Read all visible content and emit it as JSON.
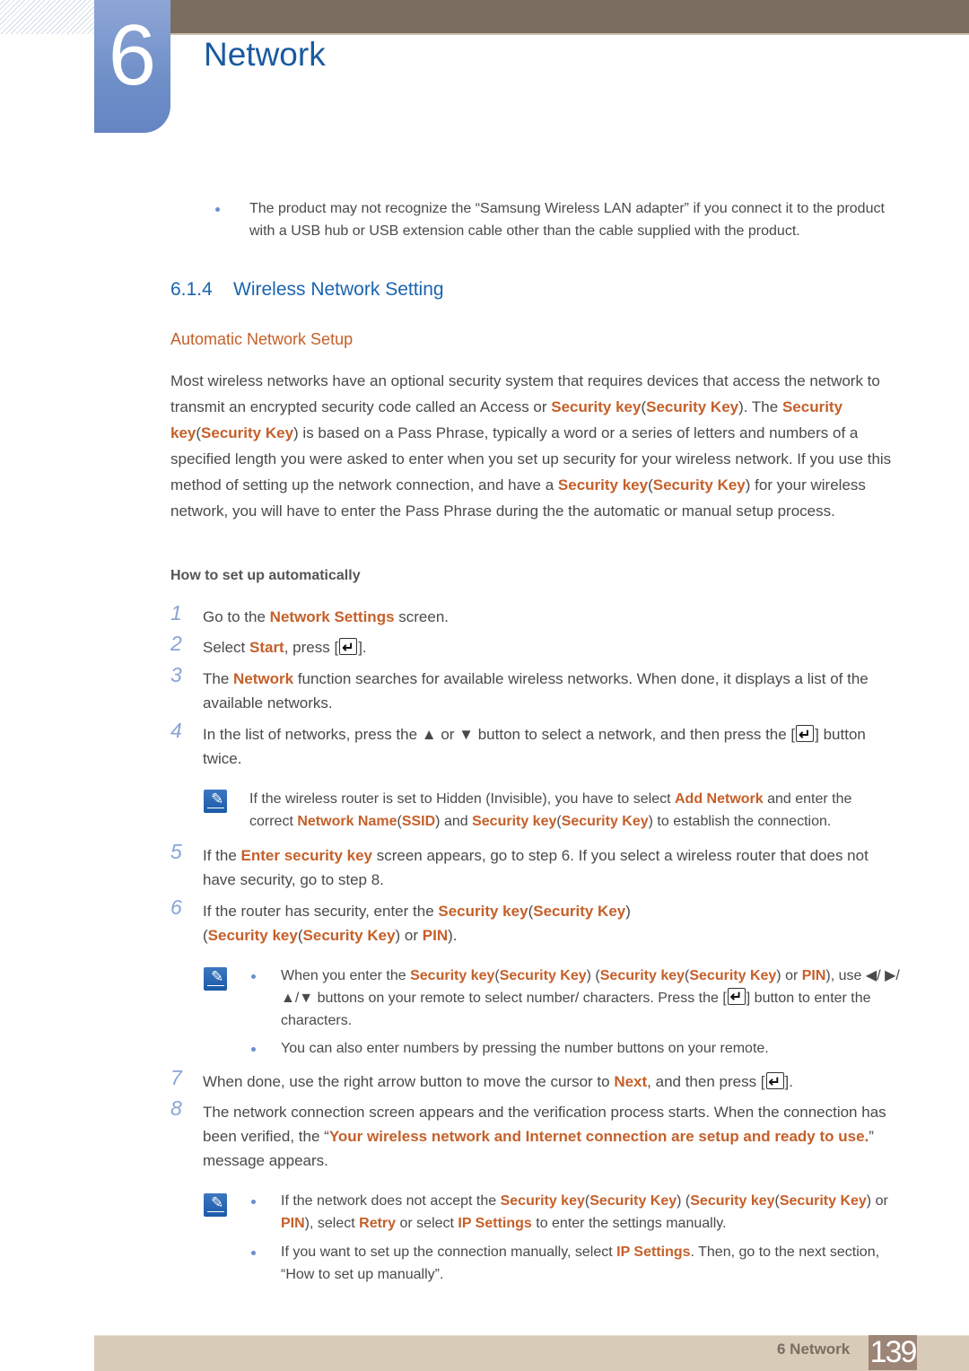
{
  "chapter": {
    "number": "6",
    "title": "Network"
  },
  "intro_bullet": "The product may not recognize the “Samsung Wireless LAN adapter” if you connect it to the product with a USB hub or USB extension cable other than the cable supplied with the product.",
  "section": {
    "number": "6.1.4",
    "title": "Wireless Network Setting"
  },
  "subsection": "Automatic Network Setup",
  "paragraph": {
    "p1": "Most wireless networks have an optional security system that requires devices that access the network to transmit an encrypted security code called an Access or ",
    "k1": "Security key",
    "p2": "(",
    "k2": "Security Key",
    "p3": "). The ",
    "k3": "Security key",
    "p4": "(",
    "k4": "Security Key",
    "p5": ") is based on a Pass Phrase, typically a word or a series of letters and numbers of a specified length you were asked to enter when you set up security for your wireless network. If you use this method of setting up the network connection, and have a ",
    "k5": "Security key",
    "p6": "(",
    "k6": "Security Key",
    "p7": ") for your wireless network, you will have to enter the Pass Phrase during the the automatic or manual setup process."
  },
  "how_to_heading": "How to set up automatically",
  "steps": [
    {
      "n": "1",
      "a": "Go to the ",
      "k": "Network Settings",
      "b": " screen."
    },
    {
      "n": "2",
      "a": "Select ",
      "k": "Start",
      "b": ", press [",
      "c": "]."
    },
    {
      "n": "3",
      "a": "The ",
      "k": "Network",
      "b": " function searches for available wireless networks. When done, it displays a list of the available networks."
    },
    {
      "n": "4",
      "a": "In the list of networks, press the ▲ or ▼ button to select a network, and then press the [",
      "b": "] button twice."
    },
    {
      "n": "5",
      "a": "If the ",
      "k": "Enter security key",
      "b": " screen appears, go to step 6. If you select a wireless router that does not have security, go to step 8."
    },
    {
      "n": "6",
      "a": "If the router has security, enter the ",
      "k1": "Security key",
      "b": "(",
      "k2": "Security Key",
      "c": ")",
      "d": "(",
      "k3": "Security key",
      "e": "(",
      "k4": "Security Key",
      "f": ") or ",
      "k5": "PIN",
      "g": ")."
    },
    {
      "n": "7",
      "a": "When done, use the right arrow button to move the cursor to ",
      "k": "Next",
      "b": ", and then press [",
      "c": "]."
    },
    {
      "n": "8",
      "a": "The network connection screen appears and the verification process starts. When the connection has been verified, the “",
      "k": "Your wireless network and Internet connection are setup and ready to use.",
      "b": "” message appears."
    }
  ],
  "note1": {
    "a": "If the wireless router is set to Hidden (Invisible), you have to select ",
    "k1": "Add Network",
    "b": " and enter the correct ",
    "k2": "Network Name",
    "c": "(",
    "k3": "SSID",
    "d": ") and ",
    "k4": "Security key",
    "e": "(",
    "k5": "Security Key",
    "f": ") to establish the connection."
  },
  "note2": [
    {
      "a": "When you enter the ",
      "k1": "Security key",
      "b": "(",
      "k2": "Security Key",
      "c": ") (",
      "k3": "Security key",
      "d": "(",
      "k4": "Security Key",
      "e": ") or ",
      "k5": "PIN",
      "f": "), use ◀/ ▶/▲/▼ buttons on your remote to select number/ characters. Press the [",
      "g": "] button to enter the characters."
    },
    {
      "a": "You can also enter numbers by pressing the number buttons on your remote."
    }
  ],
  "note3": [
    {
      "a": "If the network does not accept the ",
      "k1": "Security key",
      "b": "(",
      "k2": "Security Key",
      "c": ") (",
      "k3": "Security key",
      "d": "(",
      "k4": "Security Key",
      "e": ") or ",
      "k5": "PIN",
      "f": "), select ",
      "k6": "Retry",
      "g": " or select ",
      "k7": "IP Settings",
      "h": " to enter the settings manually."
    },
    {
      "a": "If you want to set up the connection manually, select ",
      "k": "IP Settings",
      "b": ". Then, go to the next section, “How to set up manually”."
    }
  ],
  "footer": {
    "label": "6 Network",
    "page": "139"
  }
}
